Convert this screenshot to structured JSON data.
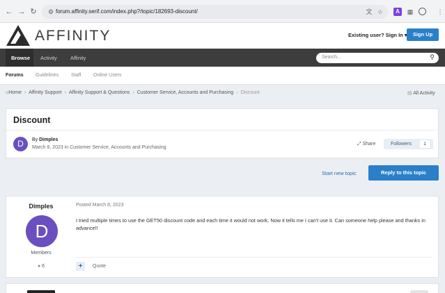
{
  "browser": {
    "url": "forum.affinity.serif.com/index.php?/topic/182693-discount/",
    "extension_a_label": "A"
  },
  "header": {
    "brand": "AFFINITY",
    "signin": "Existing user? Sign In",
    "signup": "Sign Up"
  },
  "nav": {
    "items": [
      "Browse",
      "Activity",
      "Affinity"
    ],
    "search_placeholder": "Search..."
  },
  "subnav": {
    "items": [
      "Forums",
      "Guidelines",
      "Staff",
      "Online Users"
    ]
  },
  "breadcrumb": {
    "items": [
      "Home",
      "Affinity Support",
      "Affinity Support & Questions",
      "Customer Service, Accounts and Purchasing",
      "Discount"
    ],
    "all_activity": "All Activity"
  },
  "topic": {
    "title": "Discount",
    "avatar_letter": "D",
    "by_prefix": "By",
    "author": "Dimples",
    "meta": "March 8, 2023 in Customer Service, Accounts and Purchasing",
    "share": "Share",
    "followers_label": "Followers",
    "followers_count": "1"
  },
  "actions": {
    "start_new_topic": "Start new topic",
    "reply": "Reply to this topic"
  },
  "post": {
    "author": "Dimples",
    "avatar_letter": "D",
    "group": "Members",
    "post_count": "6",
    "posted": "Posted March 8, 2023",
    "body": "I tried multiple times to use the GET50 discount code and each time it would not work. Now it tells me I can't use it. Can someone help please and thanks in advance!!",
    "quote": "Quote"
  }
}
